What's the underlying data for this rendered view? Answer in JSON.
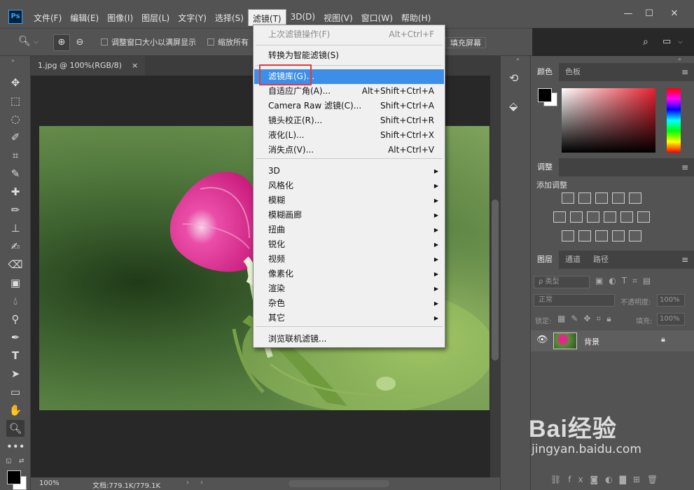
{
  "app": {
    "logo": "Ps"
  },
  "menubar": {
    "items": [
      "文件(F)",
      "编辑(E)",
      "图像(I)",
      "图层(L)",
      "文字(Y)",
      "选择(S)",
      "滤镜(T)",
      "3D(D)",
      "视图(V)",
      "窗口(W)",
      "帮助(H)"
    ],
    "active": "滤镜(T)"
  },
  "window_controls": {
    "minimize": "—",
    "maximize": "☐",
    "close": "✕"
  },
  "options_bar": {
    "tool_icon": "zoom-icon",
    "checkbox1_label": "调整窗口大小以满屏显示",
    "checkbox2_label": "缩放所有",
    "fill_screen": "填充屏幕"
  },
  "document": {
    "tab_title": "1.jpg @ 100%(RGB/8)",
    "tab_close": "×",
    "zoom": "100%",
    "doc_info": "文档:779.1K/779.1K"
  },
  "filter_menu": {
    "items": [
      {
        "label": "上次滤镜操作(F)",
        "shortcut": "Alt+Ctrl+F",
        "disabled": true
      },
      {
        "label": "转换为智能滤镜(S)",
        "shortcut": ""
      },
      {
        "label": "滤镜库(G)...",
        "shortcut": "",
        "highlighted": true
      },
      {
        "label": "自适应广角(A)...",
        "shortcut": "Alt+Shift+Ctrl+A"
      },
      {
        "label": "Camera Raw 滤镜(C)...",
        "shortcut": "Shift+Ctrl+A"
      },
      {
        "label": "镜头校正(R)...",
        "shortcut": "Shift+Ctrl+R"
      },
      {
        "label": "液化(L)...",
        "shortcut": "Shift+Ctrl+X"
      },
      {
        "label": "消失点(V)...",
        "shortcut": "Alt+Ctrl+V"
      },
      {
        "label": "3D",
        "submenu": true
      },
      {
        "label": "风格化",
        "submenu": true
      },
      {
        "label": "模糊",
        "submenu": true
      },
      {
        "label": "模糊画廊",
        "submenu": true
      },
      {
        "label": "扭曲",
        "submenu": true
      },
      {
        "label": "锐化",
        "submenu": true
      },
      {
        "label": "视频",
        "submenu": true
      },
      {
        "label": "像素化",
        "submenu": true
      },
      {
        "label": "渲染",
        "submenu": true
      },
      {
        "label": "杂色",
        "submenu": true
      },
      {
        "label": "其它",
        "submenu": true
      },
      {
        "label": "浏览联机滤镜...",
        "shortcut": ""
      }
    ]
  },
  "color_panel": {
    "tabs": [
      "颜色",
      "色板"
    ]
  },
  "adjust_panel": {
    "tab": "调整",
    "add_label": "添加调整"
  },
  "layers_panel": {
    "tabs": [
      "图层",
      "通道",
      "路径"
    ],
    "filter_kind": "ρ 类型",
    "blend_mode": "正常",
    "opacity_label": "不透明度:",
    "opacity_value": "100%",
    "lock_label": "锁定:",
    "fill_label": "填充:",
    "fill_value": "100%",
    "layer_name": "背景"
  },
  "watermark": {
    "text": "Bai经验",
    "url": "jingyan.baidu.com"
  },
  "colors": {
    "menu_highlight": "#3d8ee8",
    "highlight_box": "#e23a3a",
    "flower": "#e0288c"
  }
}
